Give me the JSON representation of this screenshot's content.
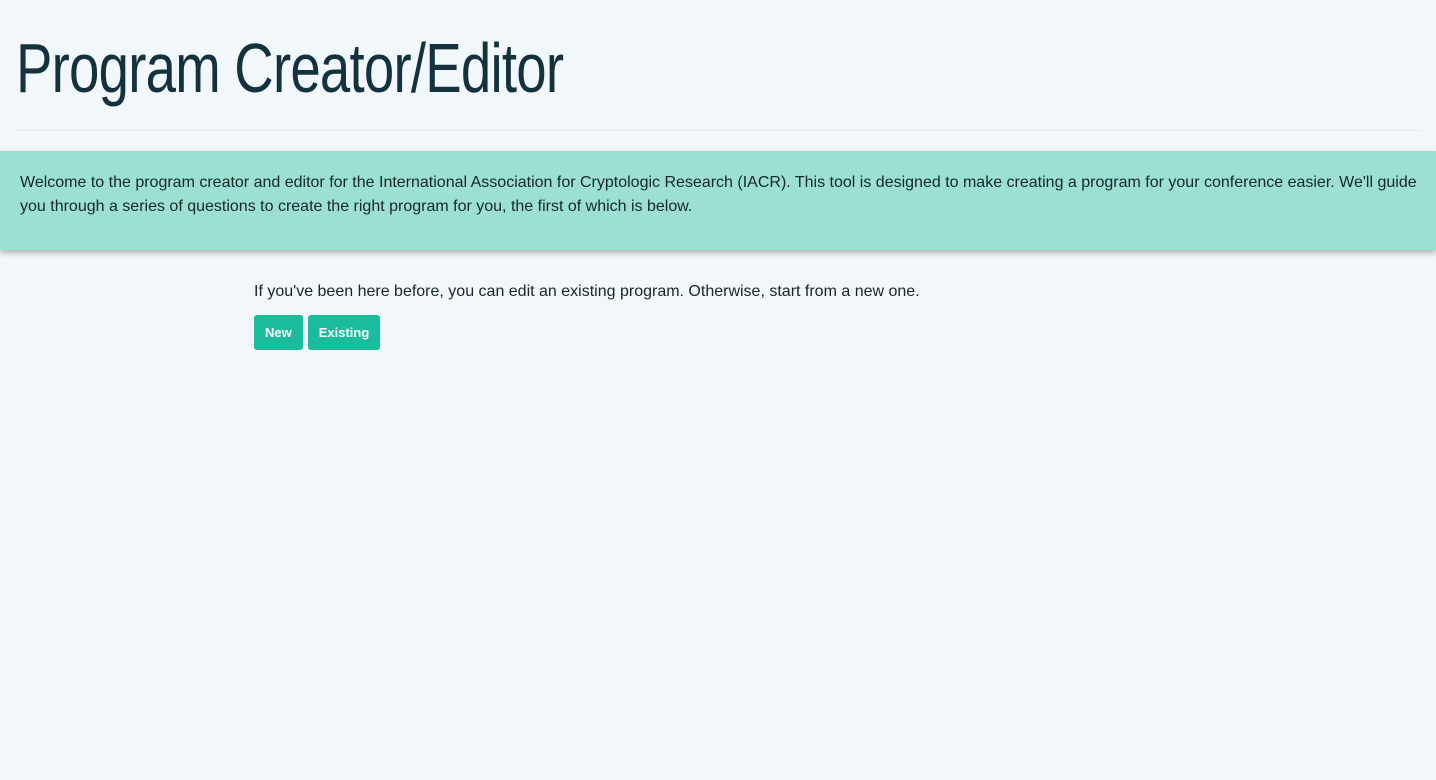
{
  "header": {
    "title": "Program Creator/Editor"
  },
  "welcome": {
    "text": "Welcome to the program creator and editor for the International Association for Cryptologic Research (IACR). This tool is designed to make creating a program for your conference easier. We'll guide you through a series of questions to create the right program for you, the first of which is below."
  },
  "main": {
    "prompt": "If you've been here before, you can edit an existing program. Otherwise, start from a new one.",
    "new_button_label": "New",
    "existing_button_label": "Existing"
  },
  "colors": {
    "background": "#f1f7fa",
    "title": "#13323d",
    "banner": "#9be0d3",
    "button": "#1abc9c",
    "button_text": "#ffffff"
  }
}
